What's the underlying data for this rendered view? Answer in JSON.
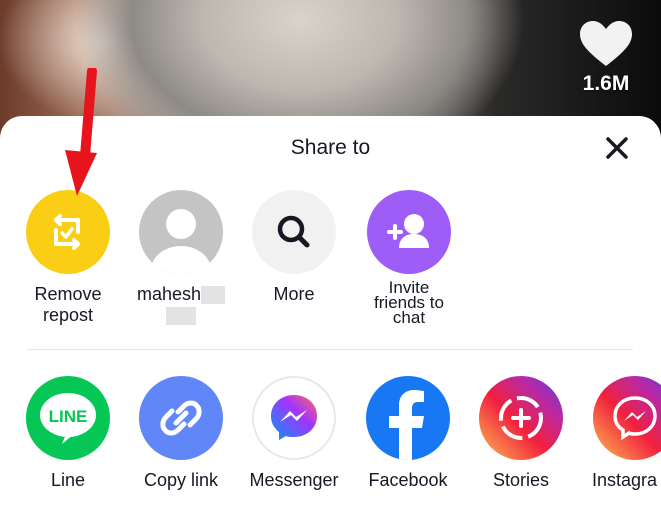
{
  "video": {
    "likes": "1.6M",
    "heart_icon": "heart-icon"
  },
  "sheet": {
    "title": "Share to",
    "close_icon": "close-icon",
    "row1": [
      {
        "label": "Remove repost",
        "color": "#FACE15",
        "icon": "repost-icon"
      },
      {
        "label": "mahesh",
        "color": "#C4C4C4",
        "icon": "avatar-icon"
      },
      {
        "label": "More",
        "color": "#F1F1F2",
        "icon": "search-icon"
      },
      {
        "label": "Invite friends to chat",
        "color": "#9F5DF7",
        "icon": "add-friend-icon"
      }
    ],
    "row2": [
      {
        "label": "Line",
        "color": "#06C755",
        "icon": "line-icon"
      },
      {
        "label": "Copy link",
        "color": "#6086F7",
        "icon": "link-icon"
      },
      {
        "label": "Messenger",
        "color": "#FFFFFF",
        "icon": "messenger-icon"
      },
      {
        "label": "Facebook",
        "color": "#1877F2",
        "icon": "facebook-icon"
      },
      {
        "label": "Stories",
        "color": "#E4405F",
        "icon": "stories-icon"
      },
      {
        "label": "Instagra",
        "color": "#E1306C",
        "icon": "instagram-icon"
      }
    ]
  },
  "annotation": {
    "arrow_color": "#E8141C"
  }
}
